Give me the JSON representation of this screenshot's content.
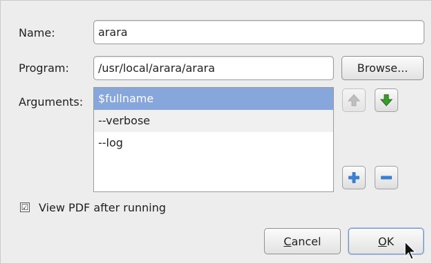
{
  "form": {
    "name_label": "Name:",
    "name_value": "arara",
    "program_label": "Program:",
    "program_value": "/usr/local/arara/arara",
    "browse_label": "Browse...",
    "arguments_label": "Arguments:",
    "arguments": [
      {
        "text": "$fullname",
        "selected": true
      },
      {
        "text": "--verbose",
        "selected": false
      },
      {
        "text": "--log",
        "selected": false
      }
    ],
    "view_pdf_label": "View PDF after running",
    "view_pdf_checked": "☑"
  },
  "buttons": {
    "cancel_mnemonic": "C",
    "cancel_rest": "ancel",
    "ok_mnemonic": "O",
    "ok_rest": "K"
  },
  "icons": {
    "move_up": "arrow-up-icon",
    "move_down": "arrow-down-icon",
    "add": "plus-icon",
    "remove": "minus-icon"
  },
  "colors": {
    "selection": "#86a6dc",
    "down_arrow": "#3a9a2a",
    "add_icon": "#3b7fd0"
  }
}
